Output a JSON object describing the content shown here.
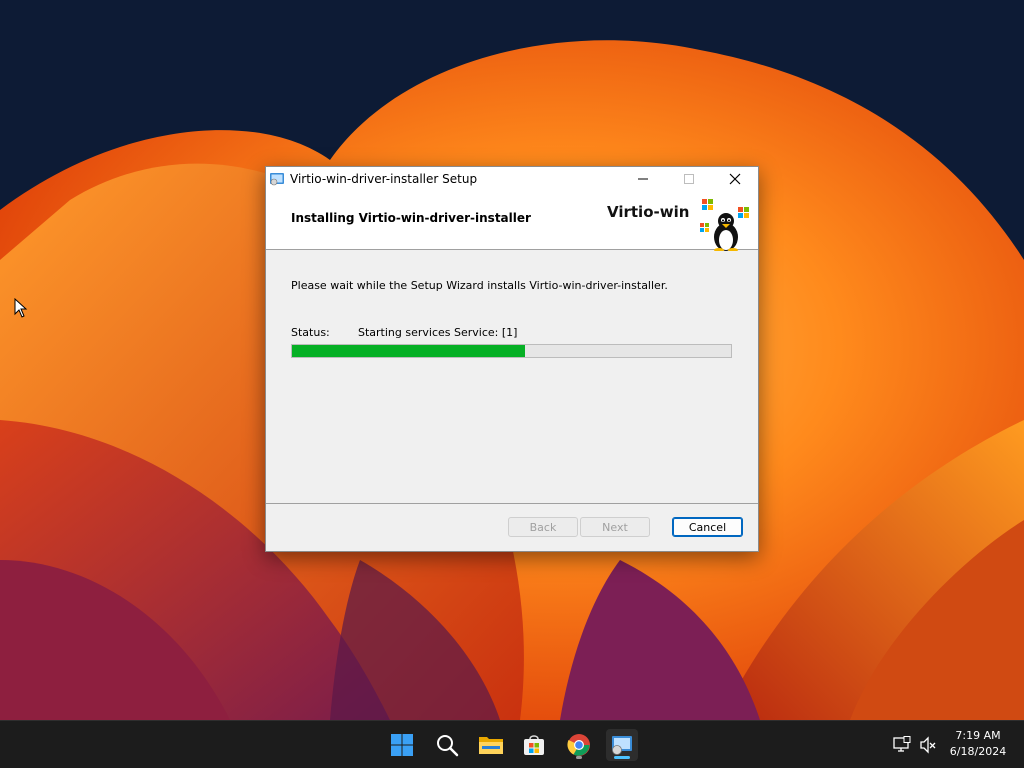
{
  "window": {
    "title": "Virtio-win-driver-installer Setup",
    "banner_title": "Installing Virtio-win-driver-installer",
    "logo_text": "Virtio-win",
    "description": "Please wait while the Setup Wizard installs Virtio-win-driver-installer.",
    "status_label": "Status:",
    "status_value": "Starting services Service: [1]",
    "progress_percent": 53,
    "buttons": {
      "back": "Back",
      "next": "Next",
      "cancel": "Cancel"
    },
    "caption_icons": [
      "minimize-icon",
      "maximize-icon",
      "close-icon"
    ]
  },
  "taskbar": {
    "icons": [
      "start-icon",
      "search-icon",
      "file-explorer-icon",
      "microsoft-store-icon",
      "chrome-icon",
      "setup-app-icon"
    ],
    "tray_icons": [
      "network-icon",
      "volume-muted-icon"
    ],
    "time": "7:19 AM",
    "date": "6/18/2024"
  },
  "colors": {
    "accent": "#0067c0",
    "progress": "#06b025",
    "taskbar": "#1c1c1c"
  }
}
